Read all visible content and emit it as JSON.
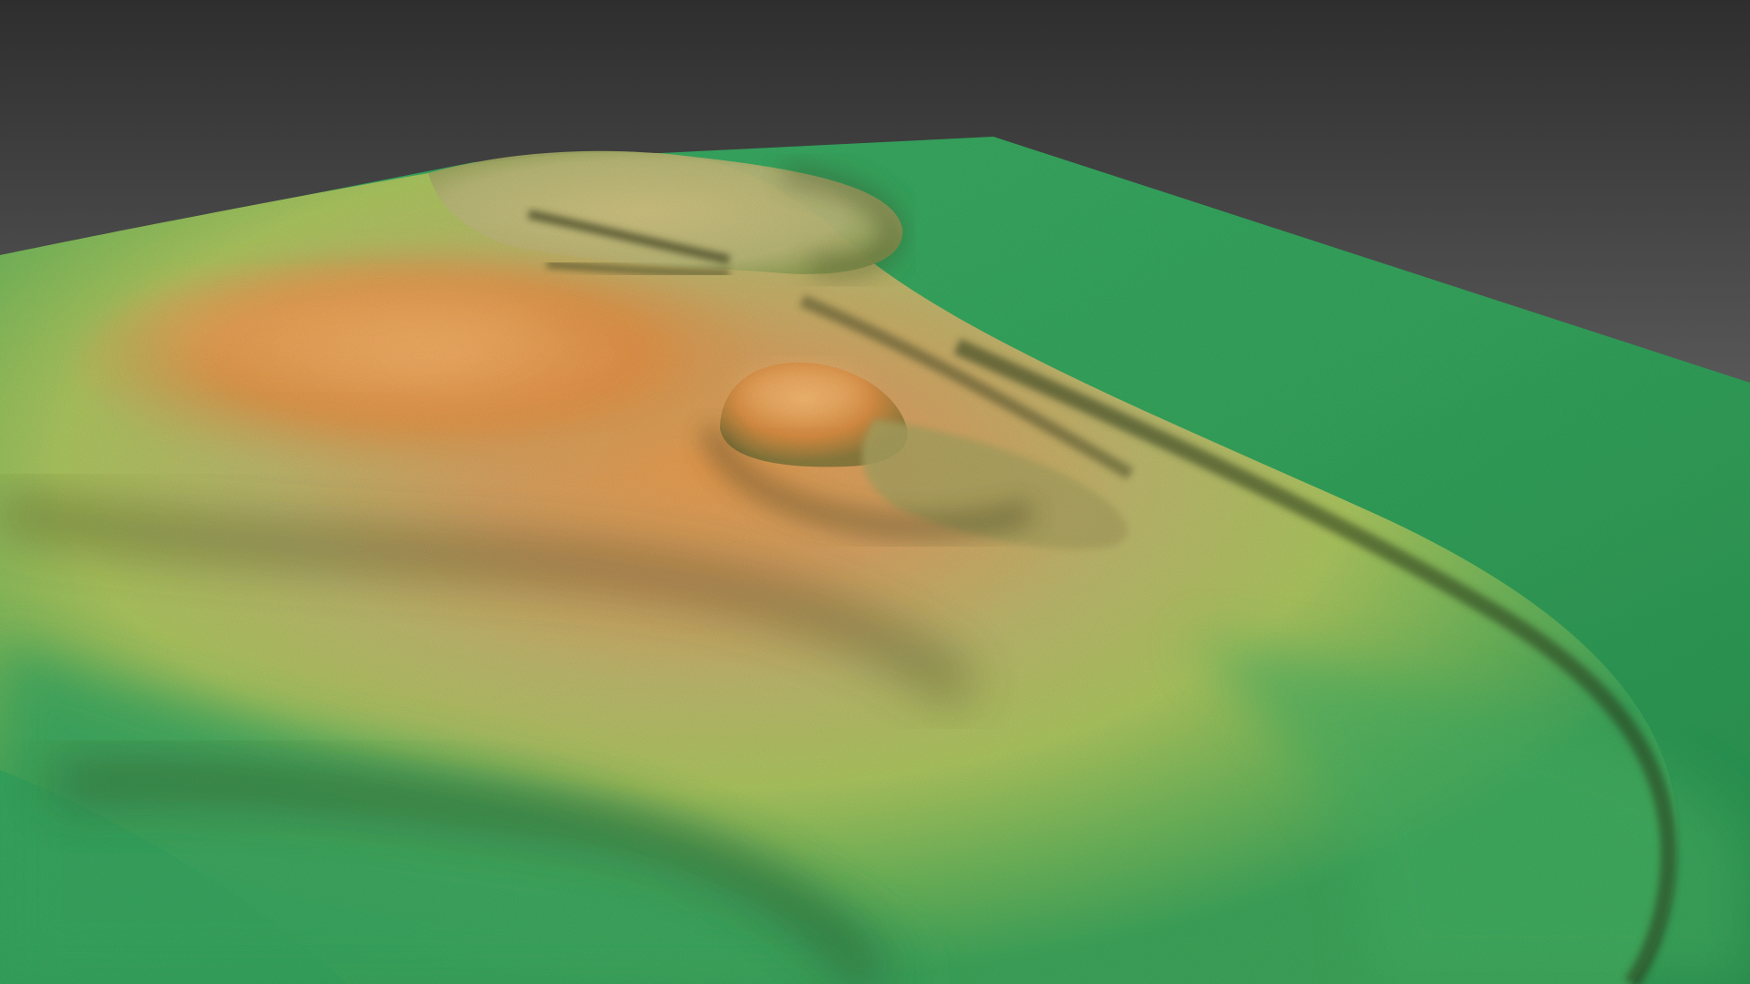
{
  "scene": {
    "subject": "shaded-relief-terrain-render",
    "palette": {
      "background_top": "#2f2f2f",
      "background_bottom": "#7a7a7a",
      "lowland_green": "#2fa05a",
      "lowland_green_light": "#46b86a",
      "slope_green_yellow": "#a9c45c",
      "plateau_khaki": "#c9b873",
      "summit_orange": "#e0944a",
      "summit_orange_light": "#eea860",
      "shadow_olive": "#4a4a26"
    }
  }
}
